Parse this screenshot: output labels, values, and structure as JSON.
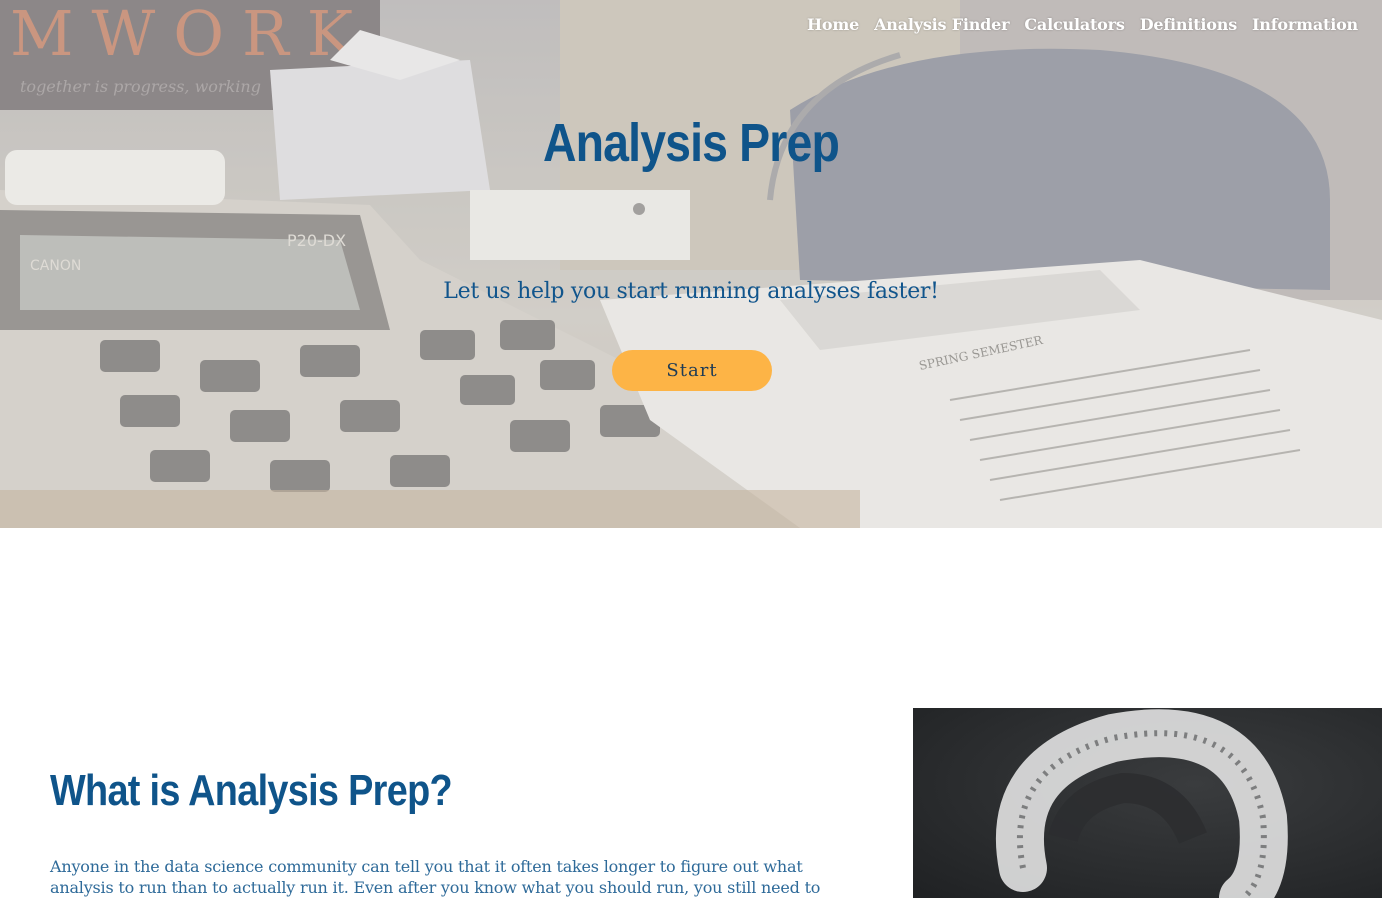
{
  "nav": {
    "items": [
      "Home",
      "Analysis Finder",
      "Calculators",
      "Definitions",
      "Information"
    ]
  },
  "hero": {
    "title": "Analysis Prep",
    "subtitle": "Let us help you start running analyses faster!",
    "start_label": "Start",
    "background_text": {
      "banner_text": "MWORK",
      "banner_subtext": "together is progress, working",
      "calculator_model": "P20-DX",
      "calculator_brand": "CANON",
      "paper_heading": "SPRING SEMESTER"
    }
  },
  "about": {
    "title": "What is Analysis Prep?",
    "text": "Anyone in the data science community can tell you that it often takes longer to figure out what analysis to run than to actually run it. Even after you know what you should run, you still need to"
  },
  "colors": {
    "primary_blue": "#0f548a",
    "accent_orange": "#fdb446",
    "body_text": "#2e6a99",
    "chalkboard": "#2a2c2e"
  }
}
